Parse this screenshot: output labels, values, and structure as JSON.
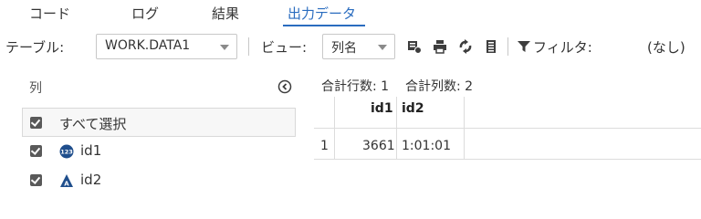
{
  "tabs": [
    {
      "label": "コード"
    },
    {
      "label": "ログ"
    },
    {
      "label": "結果"
    },
    {
      "label": "出力データ",
      "active": true
    }
  ],
  "toolbar": {
    "table_label": "テーブル:",
    "table_value": "WORK.DATA1",
    "view_label": "ビュー:",
    "view_value": "列名",
    "filter_label": "フィルタ:",
    "filter_value": "(なし)",
    "icons": [
      "format-icon",
      "print-icon",
      "refresh-icon",
      "columns-icon",
      "filter-icon"
    ]
  },
  "columns_panel": {
    "header": "列",
    "select_all": "すべて選択",
    "select_all_checked": true,
    "items": [
      {
        "name": "id1",
        "type_icon": "numeric-icon",
        "checked": true
      },
      {
        "name": "id2",
        "type_icon": "character-icon",
        "checked": true
      }
    ]
  },
  "table": {
    "row_count_text": "合計行数: 1",
    "col_count_text": "合計列数: 2",
    "headers": [
      "id1",
      "id2"
    ],
    "rows": [
      {
        "row_num": "1",
        "id1": "3661",
        "id2": "1:01:01"
      }
    ]
  },
  "colors": {
    "accent": "#2a6cbf",
    "checkbox": "#595959",
    "numeric_icon": "#1f4e8c",
    "character_icon": "#1f4e8c"
  }
}
